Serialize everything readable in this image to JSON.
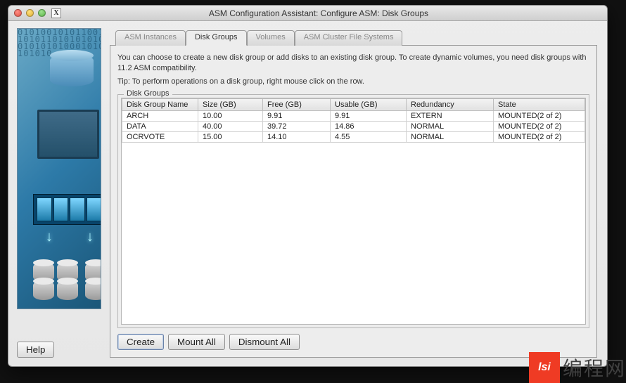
{
  "window": {
    "title": "ASM Configuration Assistant: Configure ASM: Disk Groups",
    "help_label": "Help"
  },
  "tabs": {
    "items": [
      {
        "label": "ASM Instances",
        "active": false,
        "enabled": true
      },
      {
        "label": "Disk Groups",
        "active": true,
        "enabled": true
      },
      {
        "label": "Volumes",
        "active": false,
        "enabled": false
      },
      {
        "label": "ASM Cluster File Systems",
        "active": false,
        "enabled": false
      }
    ]
  },
  "panel": {
    "description": "You can choose to create a new disk group or add disks to an existing disk group. To create dynamic volumes, you need disk groups with 11.2 ASM compatibility.",
    "tip": "Tip: To perform operations on a disk group, right mouse click on the row.",
    "group_legend": "Disk Groups"
  },
  "table": {
    "columns": [
      "Disk Group Name",
      "Size (GB)",
      "Free (GB)",
      "Usable (GB)",
      "Redundancy",
      "State"
    ],
    "rows": [
      {
        "name": "ARCH",
        "size": "10.00",
        "free": "9.91",
        "usable": "9.91",
        "redundancy": "EXTERN",
        "state": "MOUNTED(2 of 2)"
      },
      {
        "name": "DATA",
        "size": "40.00",
        "free": "39.72",
        "usable": "14.86",
        "redundancy": "NORMAL",
        "state": "MOUNTED(2 of 2)"
      },
      {
        "name": "OCRVOTE",
        "size": "15.00",
        "free": "14.10",
        "usable": "4.55",
        "redundancy": "NORMAL",
        "state": "MOUNTED(2 of 2)"
      }
    ]
  },
  "buttons": {
    "create": "Create",
    "mount_all": "Mount All",
    "dismount_all": "Dismount All"
  },
  "watermark": {
    "logo": "lsi",
    "text": "编程网"
  }
}
